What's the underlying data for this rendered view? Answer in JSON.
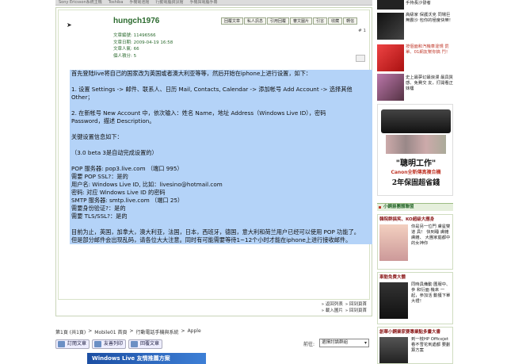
{
  "top_strip": [
    "Sony Ericsson系統主機",
    "Toshiba",
    "手機電池館",
    "行動電腦資訊館",
    "手機與電腦手冊"
  ],
  "post": {
    "author": "hungch1976",
    "meta": [
      {
        "label": "文章編號",
        "value": "11496566"
      },
      {
        "label": "文章日期",
        "value": "2009-04-19 16:58"
      },
      {
        "label": "文章人氣",
        "value": "66"
      },
      {
        "label": "個人積分",
        "value": "5"
      }
    ],
    "actions": [
      "回覆文章",
      "私人訊息",
      "引用回覆",
      "審文圖片",
      "引言",
      "收藏",
      "轉信"
    ],
    "floor": "# 1",
    "paragraphs": [
      "首先登陆live将自己的国家改为英国或者澳大利亚等等，然后开始在iphone上进行设置，如下：",
      "",
      "1. 设置 Settings -> 邮件、联系人、日历 Mail, Contacts, Calendar -> 添加帐号 Add Account -> 选择其他",
      "Other；",
      "",
      "2. 在新帐号 New Account 中，依次输入：姓名 Name，地址 Address（Windows Live ID），密码",
      "Password，描述 Description。",
      "",
      "关键设置信息如下：",
      "",
      "（3.0 beta 3是自动完成设置的）",
      "",
      "POP 服务器: pop3.live.com （端口 995）",
      "需要 POP SSL?：是的",
      "用户名: Windows Live ID, 比如：livesino@hotmail.com",
      "密码: 对应 Windows Live ID 的密码",
      "SMTP 服务器: smtp.live.com （端口 25）",
      "需要身份验证?：是的",
      "需要 TLS/SSL?：是的",
      "",
      "目前为止，英国，加拿大，澳大利亚，法国，日本，西班牙，德国，意大利和荷兰用户已经可以使用 POP 功能了。",
      "但是部分邮件会出现乱码，请各位大大注意。同时有可能需要等待1~12个小时才能在iphone上进行接收邮件。"
    ],
    "footer_links_1": [
      "» 返回列表",
      "» 回到頁首"
    ],
    "footer_links_2": [
      "» 載入圖片",
      "» 回到頁首"
    ]
  },
  "breadcrumb": [
    "第1頁 (共1頁)",
    ">",
    "Mobile01 首頁",
    ">",
    "行動電話手機與系統",
    ">",
    "Apple"
  ],
  "bottom_buttons": [
    "訂閱文章",
    "友善列印",
    "回覆文章"
  ],
  "goto": {
    "label": "前往:",
    "selected": "選擇討論群組"
  },
  "banner_text": "Windows Live  友情推薦方案",
  "sidebar": {
    "ads": [
      {
        "text": "手持長沙發者",
        "color": "#333"
      },
      {
        "text": "高級家 保護沃克 同場巨無霸沙 包你的極度快樂！",
        "color": "#555"
      },
      {
        "text": "按個面和汽機車違規 罰單、01網友幫你搞 鬥！",
        "color": "#c0392b"
      },
      {
        "text": "史上最夢幻最浪漫 最具質感、免費交 友，打開看正妹樓",
        "color": "#866"
      }
    ],
    "canon": {
      "line1": "\"聰明工作\"",
      "line2": "Canon全新傳真複合機",
      "line3": "2年保固超省錢"
    },
    "section_title": "小鋼爵團體聯盟",
    "box1": {
      "title": "韓院群搞笑、KO超級大應身",
      "text": "你是另一位門 膚星雙道 具！ 快到睡 膚雜膚雜、 大團家庭都中 的女神你"
    },
    "box2": {
      "title": "車動免費大體",
      "text": "同時具備動 圖服中、 參 和衍面 機來 一起，參加活 動獲下單大禮！"
    },
    "box3": {
      "title": "創華小鋼業家要專業點多畫大書",
      "text": "到一枝HP Officejet 看不雪花到處都 要劃算方案"
    }
  }
}
